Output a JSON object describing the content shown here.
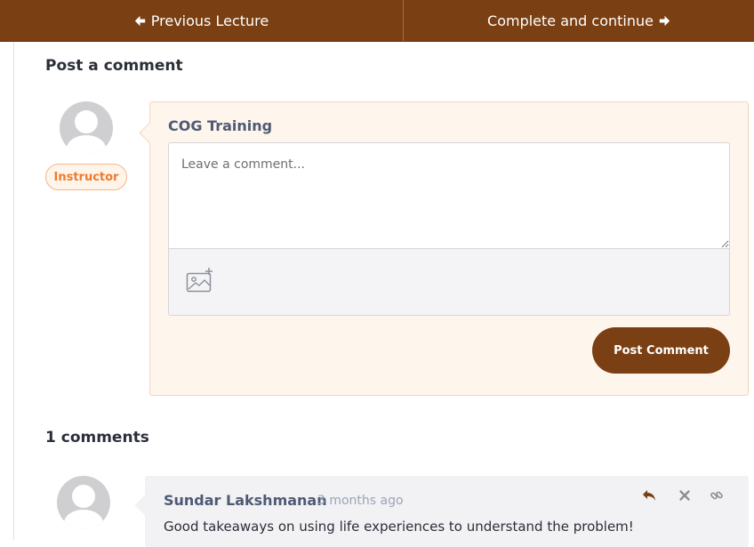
{
  "nav": {
    "previous_label": "Previous Lecture",
    "next_label": "Complete and continue"
  },
  "post_section": {
    "title": "Post a comment",
    "author_name": "COG Training",
    "role_badge": "Instructor",
    "input_placeholder": "Leave a comment...",
    "input_value": "",
    "submit_label": "Post Comment"
  },
  "comments_section": {
    "title": "1 comments",
    "comments": [
      {
        "author": "Sundar Lakshmanan",
        "time": "3 months ago",
        "text": "Good takeaways on using life experiences to understand the problem!",
        "actions": [
          "reply-icon",
          "delete-icon",
          "link-icon"
        ]
      }
    ]
  },
  "colors": {
    "brand": "#7a3f12",
    "instructor_badge": "#ee7b2c",
    "post_box_bg": "#fef5ec"
  }
}
